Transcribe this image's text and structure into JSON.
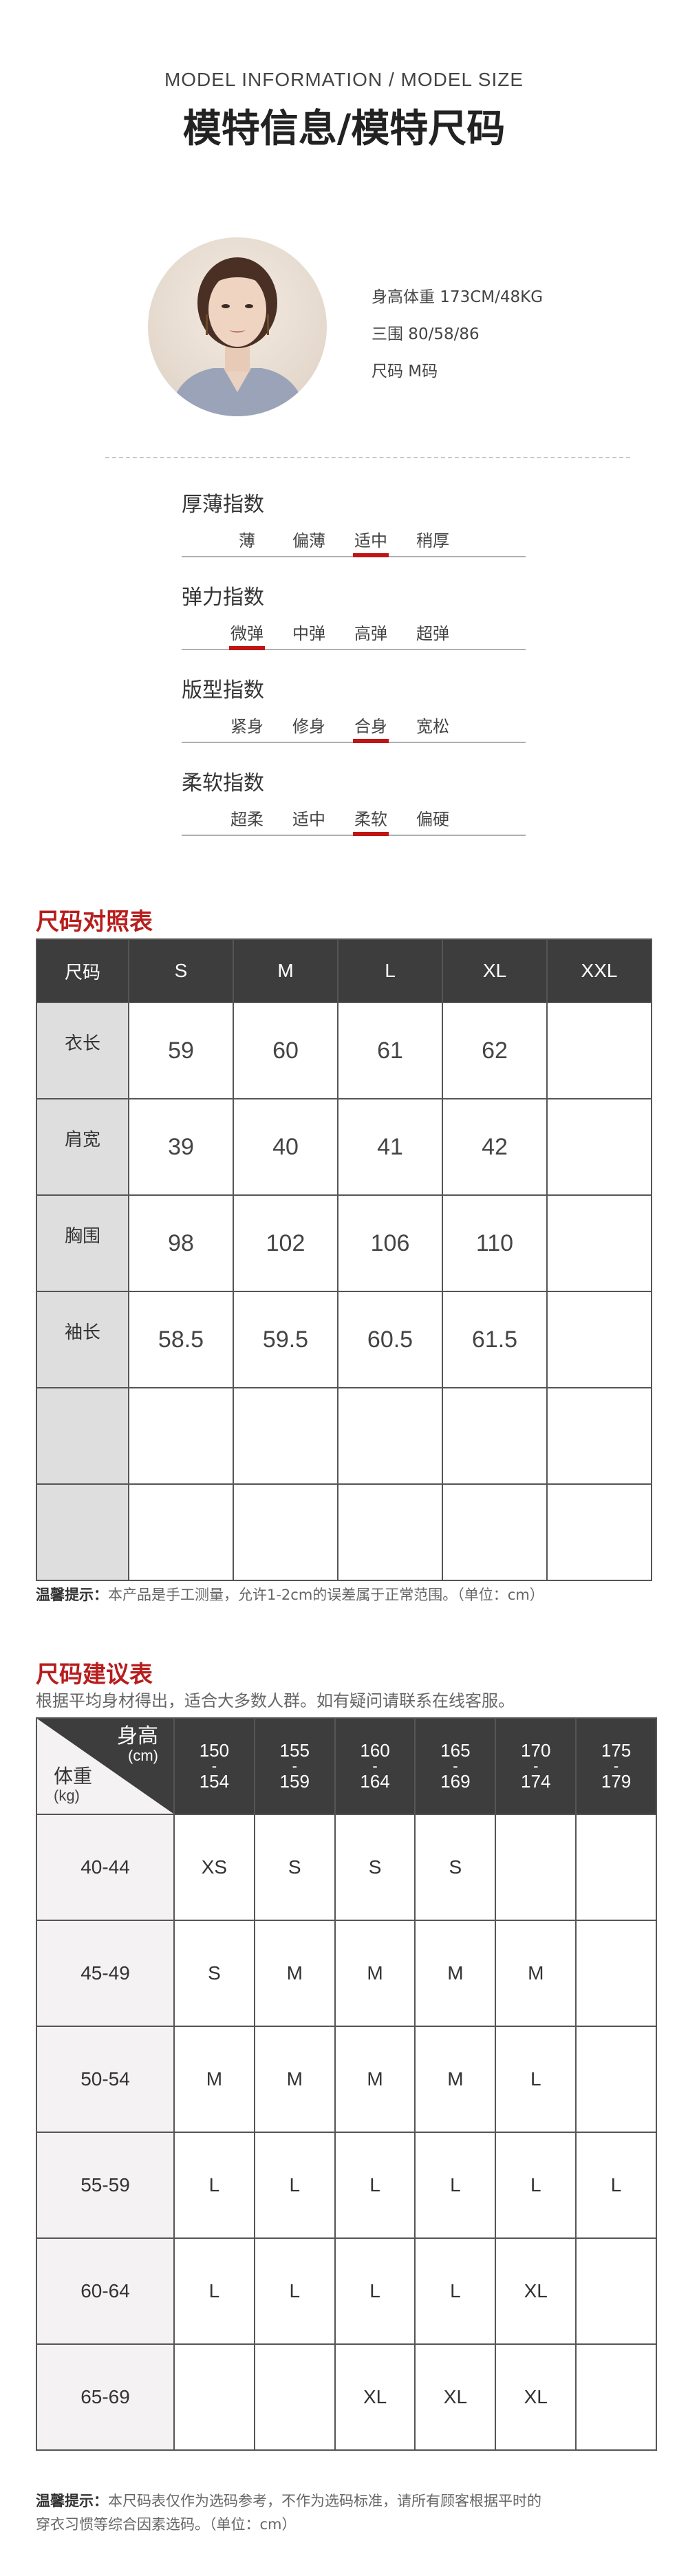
{
  "header": {
    "title_en": "MODEL INFORMATION / MODEL SIZE",
    "title_cn": "模特信息/模特尺码"
  },
  "model": {
    "height_weight": "身高体重 173CM/48KG",
    "measurements": "三围 80/58/86",
    "size": "尺码 M码"
  },
  "indices": [
    {
      "title": "厚薄指数",
      "options": [
        "薄",
        "偏薄",
        "适中",
        "稍厚"
      ],
      "selected": 2
    },
    {
      "title": "弹力指数",
      "options": [
        "微弹",
        "中弹",
        "高弹",
        "超弹"
      ],
      "selected": 0
    },
    {
      "title": "版型指数",
      "options": [
        "紧身",
        "修身",
        "合身",
        "宽松"
      ],
      "selected": 2
    },
    {
      "title": "柔软指数",
      "options": [
        "超柔",
        "适中",
        "柔软",
        "偏硬"
      ],
      "selected": 2
    }
  ],
  "size_chart": {
    "title": "尺码对照表",
    "header": [
      "尺码",
      "S",
      "M",
      "L",
      "XL",
      "XXL"
    ],
    "rows": [
      [
        "衣长",
        "59",
        "60",
        "61",
        "62",
        ""
      ],
      [
        "肩宽",
        "39",
        "40",
        "41",
        "42",
        ""
      ],
      [
        "胸围",
        "98",
        "102",
        "106",
        "110",
        ""
      ],
      [
        "袖长",
        "58.5",
        "59.5",
        "60.5",
        "61.5",
        ""
      ],
      [
        "",
        "",
        "",
        "",
        "",
        ""
      ],
      [
        "",
        "",
        "",
        "",
        "",
        ""
      ]
    ],
    "note_bold": "温馨提示：",
    "note": "本产品是手工测量，允许1-2cm的误差属于正常范围。（单位：cm）"
  },
  "recommend": {
    "title": "尺码建议表",
    "subtitle": "根据平均身材得出，适合大多数人群。如有疑问请联系在线客服。",
    "corner": {
      "top": "身高",
      "top_unit": "(cm)",
      "bottom": "体重",
      "bottom_unit": "(kg)"
    },
    "heights": [
      {
        "from": "150",
        "to": "154"
      },
      {
        "from": "155",
        "to": "159"
      },
      {
        "from": "160",
        "to": "164"
      },
      {
        "from": "165",
        "to": "169"
      },
      {
        "from": "170",
        "to": "174"
      },
      {
        "from": "175",
        "to": "179"
      }
    ],
    "rows": [
      {
        "weight": "40-44",
        "sizes": [
          "XS",
          "S",
          "S",
          "S",
          "",
          ""
        ]
      },
      {
        "weight": "45-49",
        "sizes": [
          "S",
          "M",
          "M",
          "M",
          "M",
          ""
        ]
      },
      {
        "weight": "50-54",
        "sizes": [
          "M",
          "M",
          "M",
          "M",
          "L",
          ""
        ]
      },
      {
        "weight": "55-59",
        "sizes": [
          "L",
          "L",
          "L",
          "L",
          "L",
          "L"
        ]
      },
      {
        "weight": "60-64",
        "sizes": [
          "L",
          "L",
          "L",
          "L",
          "XL",
          ""
        ]
      },
      {
        "weight": "65-69",
        "sizes": [
          "",
          "",
          "XL",
          "XL",
          "XL",
          ""
        ]
      }
    ],
    "note_bold": "温馨提示：",
    "note_line1": "本尺码表仅作为选码参考，不作为选码标准，请所有顾客根据平时的",
    "note_line2": "穿衣习惯等综合因素选码。（单位：cm）"
  },
  "colors": {
    "accent_red": "#c01515",
    "header_dark": "#3d3d3d",
    "row_header_gray": "#dedede"
  }
}
